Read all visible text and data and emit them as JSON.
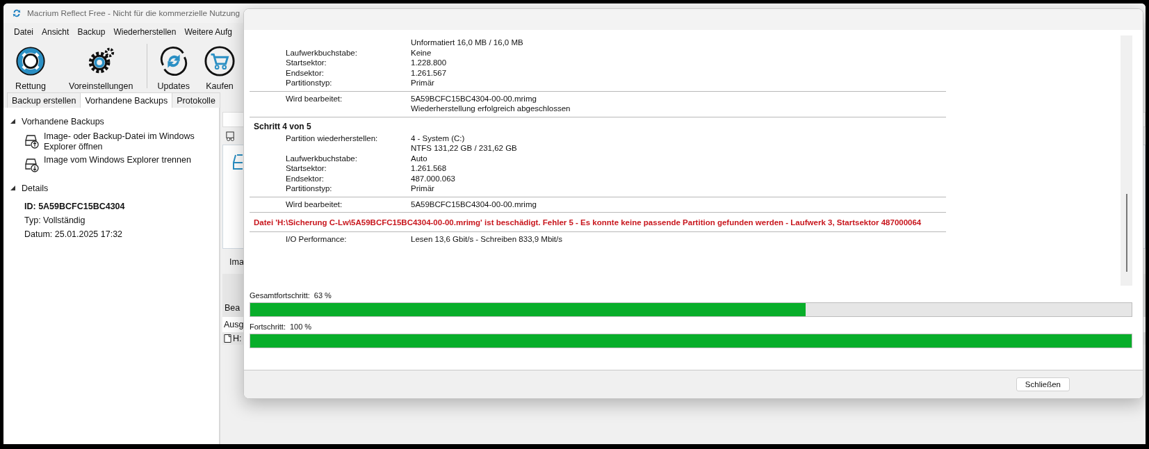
{
  "main_window": {
    "title": "Macrium Reflect Free - Nicht für die kommerzielle Nutzung",
    "menu": [
      "Datei",
      "Ansicht",
      "Backup",
      "Wiederherstellen",
      "Weitere Aufg"
    ],
    "toolbar": [
      {
        "kind": "rescue",
        "label": "Rettung"
      },
      {
        "kind": "settings",
        "label": "Voreinstellungen"
      },
      {
        "kind": "separator"
      },
      {
        "kind": "update",
        "label": "Updates"
      },
      {
        "kind": "buy",
        "label": "Kaufen"
      }
    ],
    "tabs": [
      {
        "label": "Backup erstellen",
        "selected": false
      },
      {
        "label": "Vorhandene Backups",
        "selected": true
      },
      {
        "label": "Protokolle",
        "selected": false
      }
    ],
    "tree": [
      {
        "label": "Vorhandene Backups",
        "expanded": true,
        "children": [
          {
            "kind": "mount",
            "label": "Image- oder Backup-Datei im Windows Explorer öffnen"
          },
          {
            "kind": "unmount",
            "label": "Image vom Windows Explorer trennen"
          }
        ]
      },
      {
        "label": "Details",
        "expanded": true,
        "children": [
          {
            "kind": "strong",
            "label": "ID: 5A59BCFC15BC4304"
          },
          {
            "kind": "plain",
            "label": "Typ: Vollständig"
          },
          {
            "kind": "plain",
            "label": "Datum: 25.01.2025 17:32"
          }
        ]
      }
    ],
    "right_pane": {
      "image_label": "Ima",
      "band_label": "Bea",
      "column_header": "Ausg",
      "row_cell": "H:"
    }
  },
  "dialog": {
    "log": [
      {
        "kind": "fields",
        "rows": [
          {
            "label": "",
            "values": [
              "Unformatiert 16,0 MB / 16,0 MB"
            ]
          },
          {
            "label": "Laufwerkbuchstabe:",
            "values": [
              "Keine"
            ]
          },
          {
            "label": "Startsektor:",
            "values": [
              "1.228.800"
            ]
          },
          {
            "label": "Endsektor:",
            "values": [
              "1.261.567"
            ]
          },
          {
            "label": "Partitionstyp:",
            "values": [
              "Primär"
            ]
          }
        ]
      },
      {
        "kind": "fields",
        "rows": [
          {
            "label": "Wird bearbeitet:",
            "values": [
              "5A59BCFC15BC4304-00-00.mrimg",
              "Wiederherstellung erfolgreich abgeschlossen"
            ]
          }
        ]
      },
      {
        "kind": "heading",
        "text": "Schritt 4 von 5"
      },
      {
        "kind": "fields",
        "rows": [
          {
            "label": "Partition wiederherstellen:",
            "values": [
              "4 - System (C:)",
              "NTFS 131,22 GB / 231,62 GB"
            ]
          },
          {
            "label": "Laufwerkbuchstabe:",
            "values": [
              "Auto"
            ]
          },
          {
            "label": "Startsektor:",
            "values": [
              "1.261.568"
            ]
          },
          {
            "label": "Endsektor:",
            "values": [
              "487.000.063"
            ]
          },
          {
            "label": "Partitionstyp:",
            "values": [
              "Primär"
            ]
          }
        ]
      },
      {
        "kind": "fields",
        "rows": [
          {
            "label": "Wird bearbeitet:",
            "values": [
              "5A59BCFC15BC4304-00-00.mrimg"
            ]
          }
        ]
      },
      {
        "kind": "error",
        "text": "Datei 'H:\\Sicherung C-Lw\\5A59BCFC15BC4304-00-00.mrimg' ist beschädigt. Fehler 5 - Es konnte keine passende Partition gefunden werden -  Laufwerk 3, Startsektor 487000064"
      },
      {
        "kind": "fields",
        "rows": [
          {
            "label": "I/O Performance:",
            "values": [
              "Lesen 13,6 Gbit/s - Schreiben 833,9 Mbit/s"
            ]
          }
        ]
      }
    ],
    "progress": [
      {
        "label": "Gesamtfortschritt:",
        "reading": "63 %",
        "level": 0.63
      },
      {
        "label": "Fortschritt:",
        "reading": "100 %",
        "level": 1
      }
    ],
    "buttons": [
      "Schließen"
    ]
  }
}
